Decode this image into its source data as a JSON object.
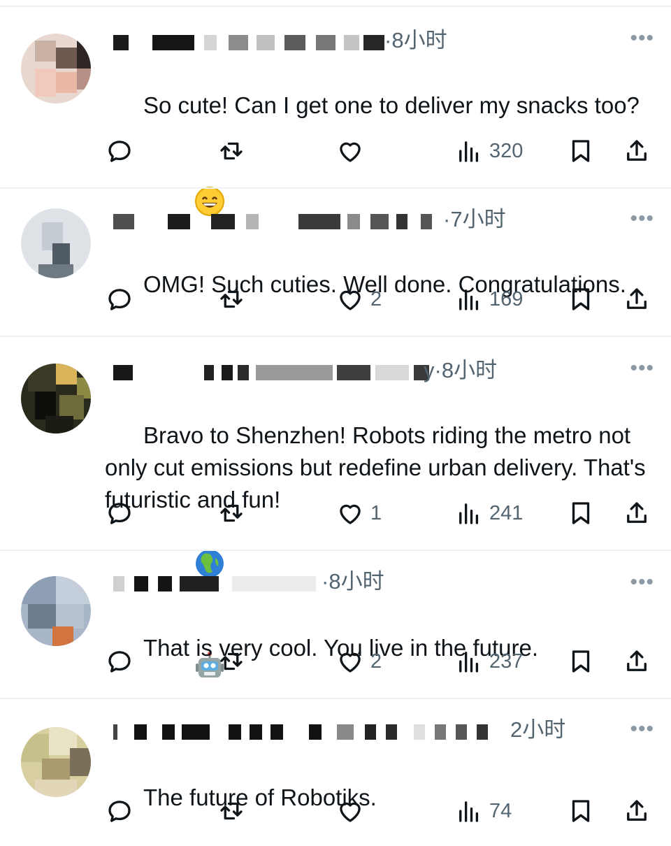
{
  "tweets": [
    {
      "time": "·8小时",
      "text": "So cute! Can I get one to deliver my snacks too?",
      "emojis": [
        "grinning-face"
      ],
      "like_count": "",
      "view_count": "320"
    },
    {
      "time": "·7小时",
      "text": "OMG! Such cuties. Well done. Congratulations.",
      "emojis": [],
      "like_count": "2",
      "view_count": "169"
    },
    {
      "time": "y·8小时",
      "text": "Bravo to Shenzhen! Robots riding the metro not only cut emissions but redefine urban delivery. That's futuristic and fun!",
      "emojis": [
        "globe-africa",
        "robot-face"
      ],
      "like_count": "1",
      "view_count": "241"
    },
    {
      "time": "·8小时",
      "text": "That is very cool. You live in the future.",
      "emojis": [],
      "like_count": "2",
      "view_count": "237"
    },
    {
      "time": "2小时",
      "text": "The future of Robotiks.",
      "emojis": [],
      "like_count": "",
      "view_count": "74"
    }
  ],
  "more_glyph": "•••",
  "colors": {
    "text": "#0f1419",
    "muted": "#536471",
    "divider": "#eff3f4"
  },
  "icons": [
    "reply-icon",
    "retweet-icon",
    "like-icon",
    "views-icon",
    "bookmark-icon",
    "share-icon"
  ]
}
